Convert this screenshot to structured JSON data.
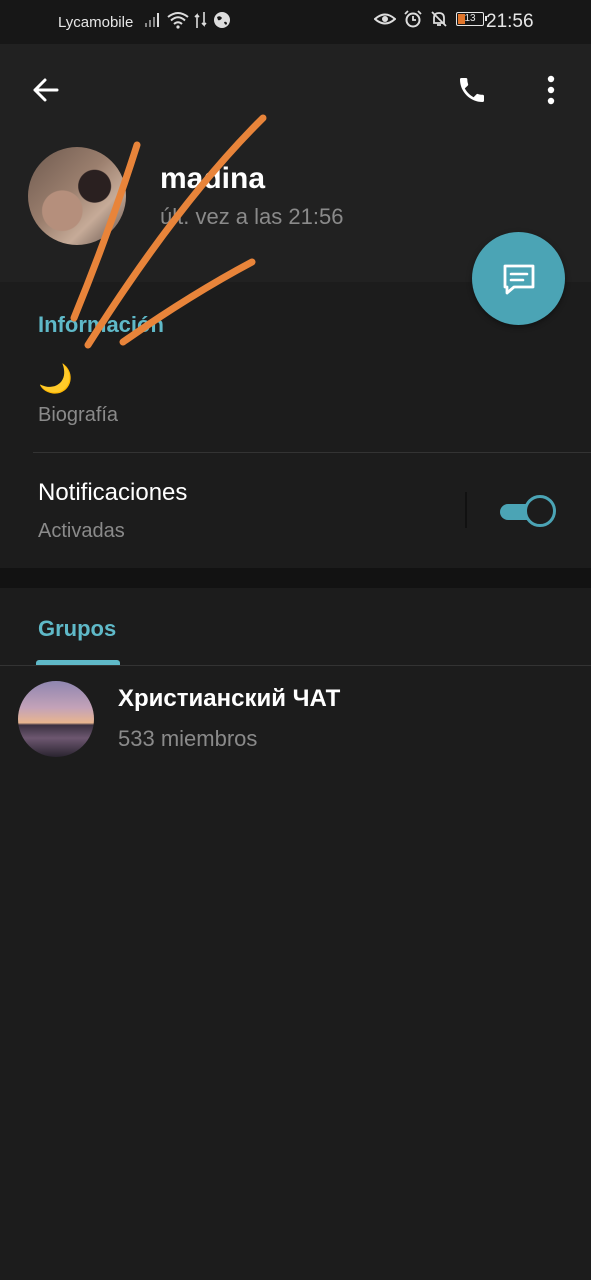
{
  "status_bar": {
    "carrier": "Lycamobile",
    "battery_level": "13",
    "time": "21:56",
    "icons": [
      "signal-icon",
      "wifi-icon",
      "data-icon",
      "globe-icon",
      "eye-icon",
      "alarm-icon",
      "mute-icon",
      "battery-icon"
    ]
  },
  "header": {
    "name": "madina",
    "last_seen": "últ. vez a las 21:56",
    "accent": "#4ba4b5"
  },
  "info": {
    "section_title": "Información",
    "bio_value": "🌙",
    "bio_label": "Biografía",
    "notifications_label": "Notificaciones",
    "notifications_status": "Activadas",
    "notifications_enabled": true
  },
  "groups": {
    "tab_label": "Grupos",
    "items": [
      {
        "name": "Христианский ЧАТ",
        "members": "533 miembros"
      }
    ]
  }
}
